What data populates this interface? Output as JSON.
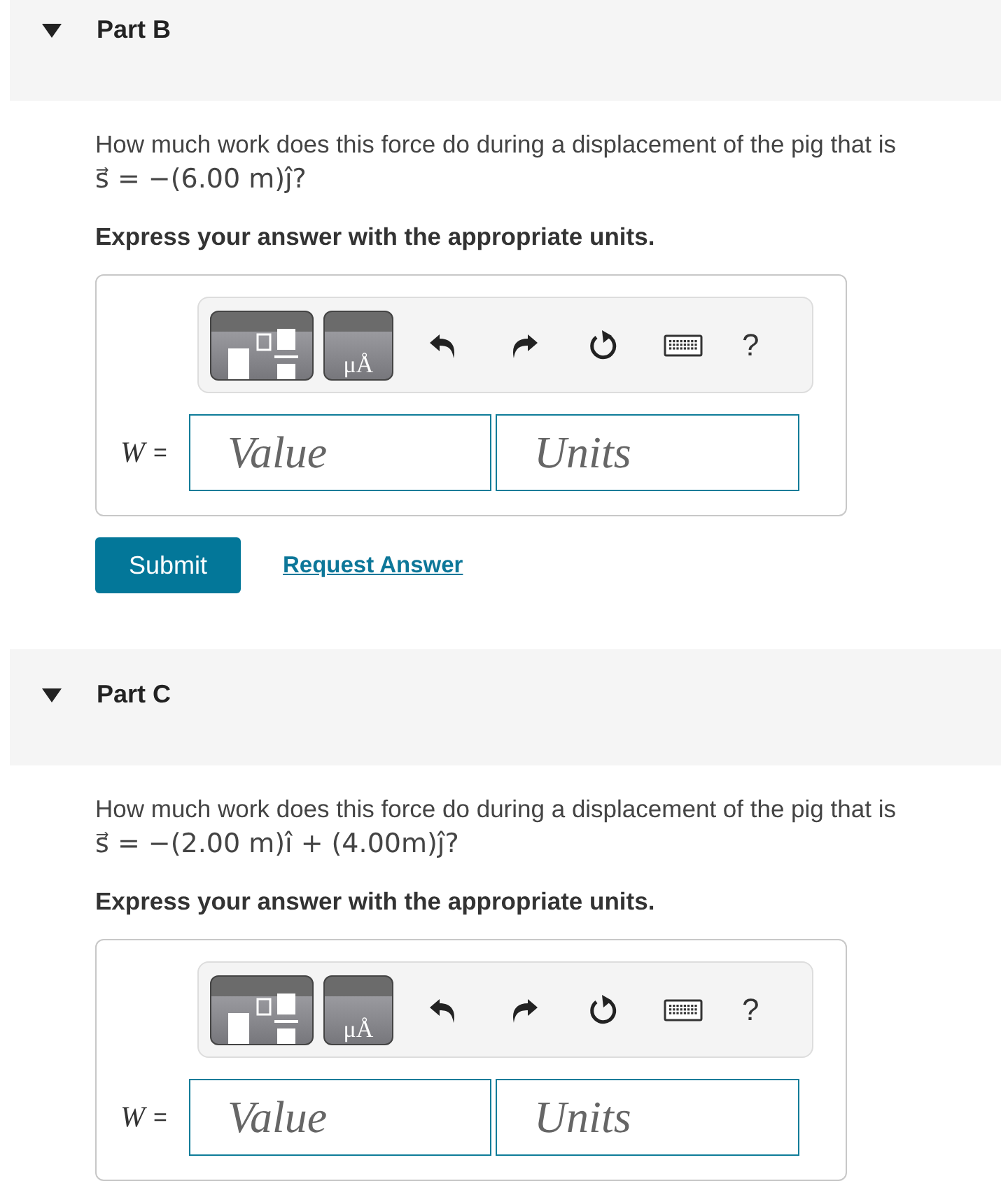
{
  "parts": [
    {
      "label": "Part B",
      "expanded": true,
      "question": "How much work does this force do during a displacement of the pig that is",
      "formula": "s⃗ = −(6.00 m)ȷ̂?",
      "instruction": "Express your answer with the appropriate units.",
      "toolbar": {
        "units_symbol": "μÅ",
        "help": "?"
      },
      "answer": {
        "variable": "W",
        "equals": "=",
        "value_placeholder": "Value",
        "units_placeholder": "Units"
      },
      "actions": {
        "submit": "Submit",
        "request": "Request Answer"
      }
    },
    {
      "label": "Part C",
      "expanded": true,
      "question": "How much work does this force do during a displacement of the pig that is",
      "formula": "s⃗ = −(2.00 m)ı̂ + (4.00m)ȷ̂?",
      "instruction": "Express your answer with the appropriate units.",
      "toolbar": {
        "units_symbol": "μÅ",
        "help": "?"
      },
      "answer": {
        "variable": "W",
        "equals": "=",
        "value_placeholder": "Value",
        "units_placeholder": "Units"
      }
    }
  ]
}
